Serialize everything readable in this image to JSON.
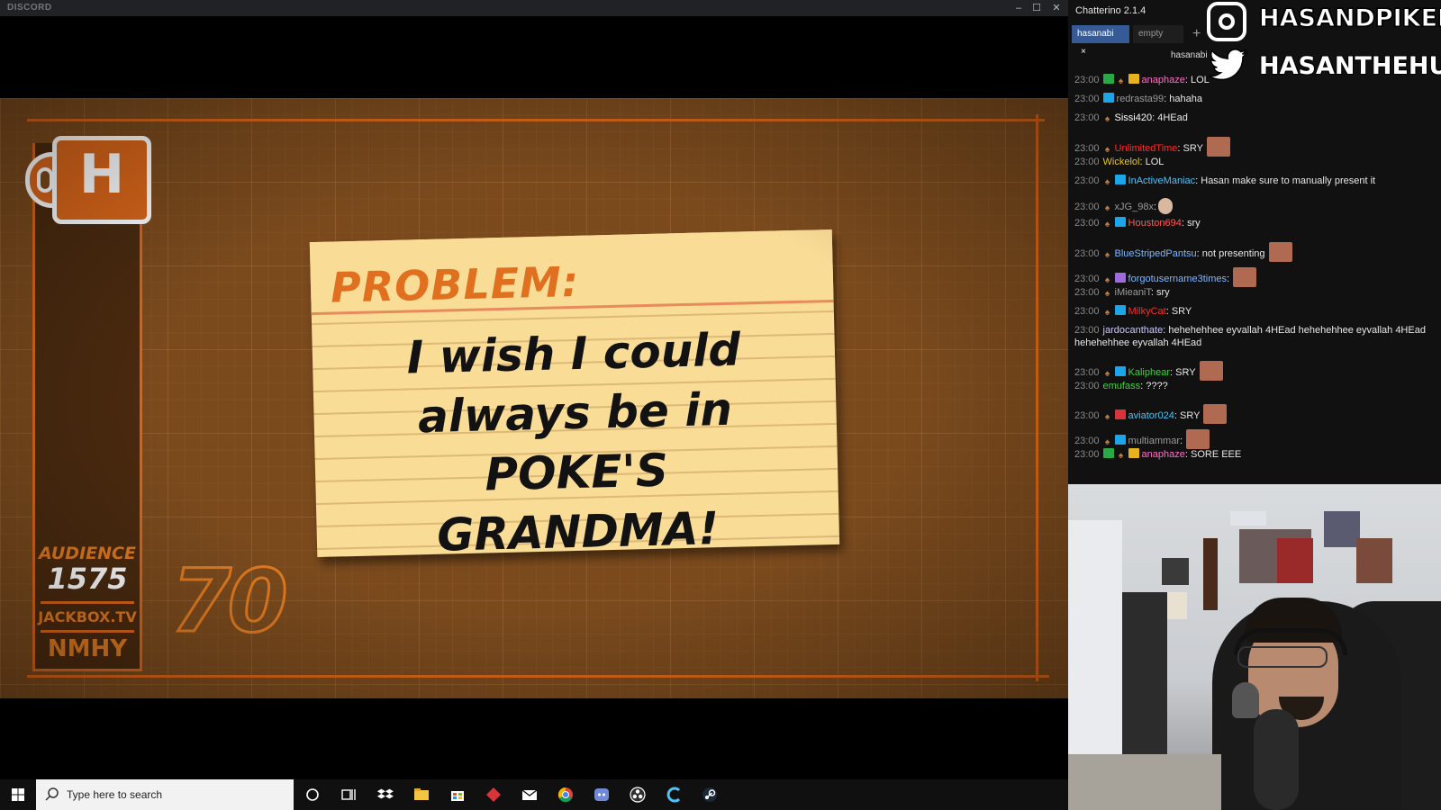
{
  "discord": {
    "title": "DISCORD",
    "controls": {
      "minimize": "–",
      "maximize": "☐",
      "close": "✕"
    }
  },
  "game": {
    "logo_letter": "H",
    "audience_label": "AUDIENCE",
    "audience_count": "1575",
    "site": "JACKBOX.TV",
    "room_code": "NMHY",
    "timer": "70",
    "card_heading": "PROBLEM:",
    "card_lines": [
      "I wish I could",
      "always be in",
      "POKE'S GRANDMA!"
    ]
  },
  "chat": {
    "title": "Chatterino 2.1.4",
    "tabs": [
      {
        "label": "hasanabi",
        "close": "×"
      },
      {
        "label": "empty"
      }
    ],
    "add_tab": "+",
    "channel": "hasanabi",
    "messages": [
      {
        "time": "23:00",
        "user": "anaphaze",
        "color": "#ff6ec7",
        "text": "LOL"
      },
      {
        "time": "23:00",
        "user": "redrasta99",
        "color": "#9a9a9a",
        "text": "hahaha"
      },
      {
        "time": "23:00",
        "user": "Sissi420",
        "color": "#ffffff",
        "text": "4HEad"
      },
      {
        "time": "23:00",
        "user": "UnlimitedTime",
        "color": "#ff2a2a",
        "text": "SRY"
      },
      {
        "time": "23:00",
        "user": "Wickelol",
        "color": "#e6c52a",
        "text": "LOL"
      },
      {
        "time": "23:00",
        "user": "InActiveManiac",
        "color": "#4fc3f7",
        "text": "Hasan make sure to manually present it"
      },
      {
        "time": "23:00",
        "user": "xJG_98x",
        "color": "#9a9a9a",
        "text": ""
      },
      {
        "time": "23:00",
        "user": "Houston694",
        "color": "#ff5a5a",
        "text": "sry"
      },
      {
        "time": "23:00",
        "user": "BlueStripedPantsu",
        "color": "#7fb8ff",
        "text": "not presenting"
      },
      {
        "time": "23:00",
        "user": "forgotusername3times",
        "color": "#7fb8ff",
        "text": ""
      },
      {
        "time": "23:00",
        "user": "iMieaniT",
        "color": "#9a9a9a",
        "text": "sry"
      },
      {
        "time": "23:00",
        "user": "MilkyCat",
        "color": "#ff2a2a",
        "text": "SRY"
      },
      {
        "time": "23:00",
        "user": "jardocanthate",
        "color": "#c8c8ff",
        "text": "hehehehhee eyvallah 4HEad hehehehhee eyvallah 4HEad",
        "cont": "hehehehhee eyvallah 4HEad"
      },
      {
        "time": "23:00",
        "user": "Kaliphear",
        "color": "#3ad43a",
        "text": "SRY"
      },
      {
        "time": "23:00",
        "user": "emufass",
        "color": "#3ad43a",
        "text": "????"
      },
      {
        "time": "23:00",
        "user": "aviator024",
        "color": "#4fc3f7",
        "text": "SRY"
      },
      {
        "time": "23:00",
        "user": "multiammar",
        "color": "#9a9a9a",
        "text": ""
      },
      {
        "time": "23:00",
        "user": "anaphaze",
        "color": "#ff6ec7",
        "text": "SORE EEE"
      }
    ]
  },
  "overlay": {
    "instagram": "HASANDPIKER",
    "twitter": "HASANTHEHUN"
  },
  "taskbar": {
    "search_placeholder": "Type here to search"
  }
}
